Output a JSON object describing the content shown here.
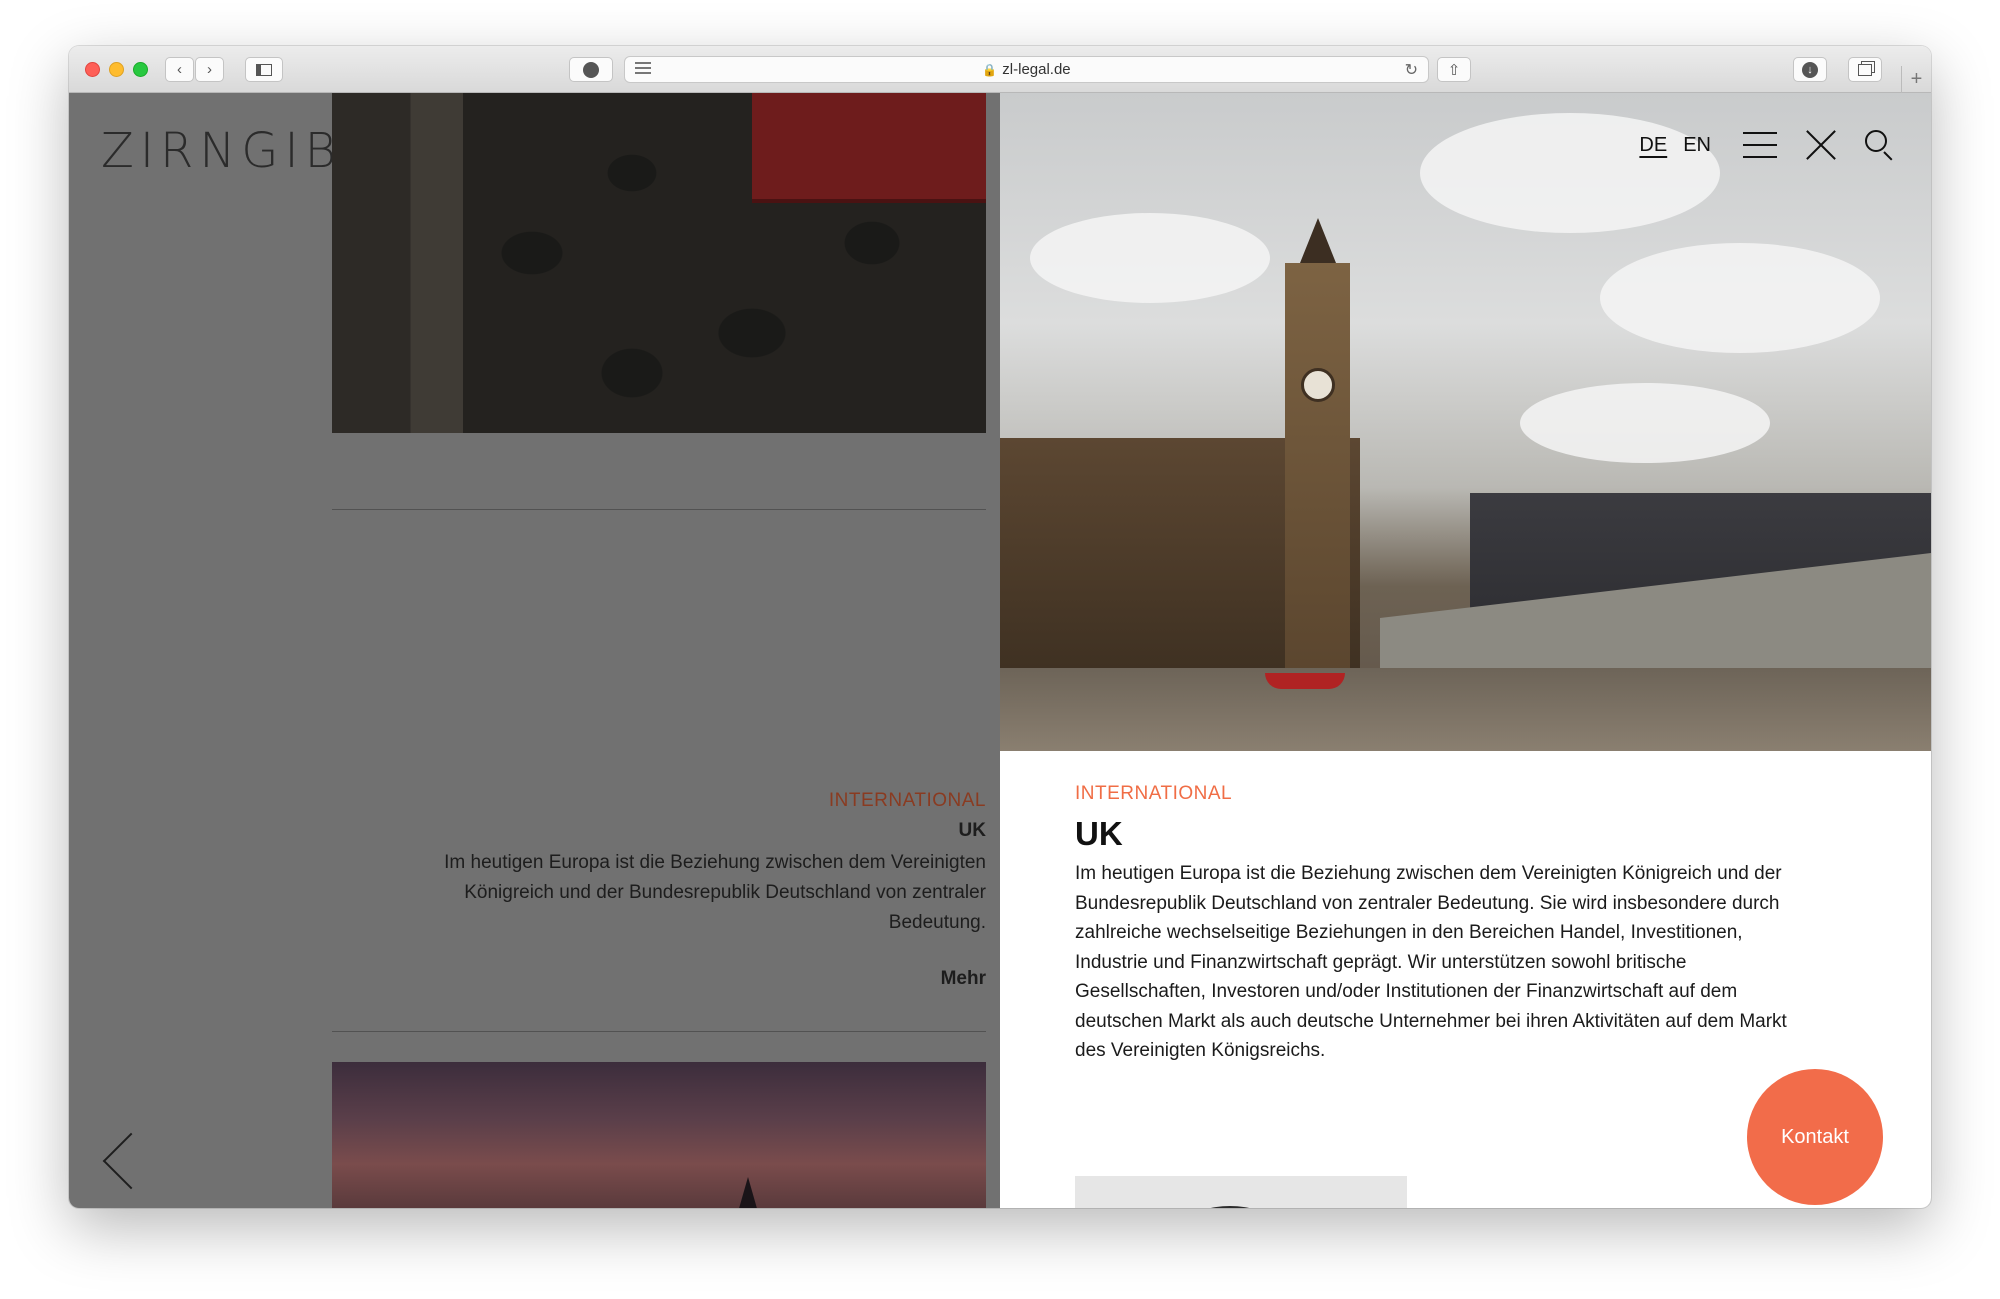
{
  "browser": {
    "url": "zl-legal.de"
  },
  "site": {
    "logo": "ZIRNGIBL"
  },
  "left_card": {
    "category": "INTERNATIONAL",
    "title": "UK",
    "text": "Im heutigen Europa ist die Beziehung zwischen dem Vereinigten Königreich und der Bundesrepublik Deutschland von zentraler Bedeutung.",
    "more_label": "Mehr"
  },
  "nav": {
    "lang_de": "DE",
    "lang_en": "EN"
  },
  "panel": {
    "category": "INTERNATIONAL",
    "title": "UK",
    "text": "Im heutigen Europa ist die Beziehung zwischen dem Vereinigten Königreich und der Bundesrepublik Deutschland von zentraler Bedeutung. Sie wird insbesondere durch zahlreiche wechselseitige Beziehungen in den Bereichen Handel, Investitionen, Industrie und Finanzwirtschaft geprägt. Wir unterstützen sowohl britische Gesellschaften, Investoren und/oder Institutionen der Finanzwirtschaft auf dem deutschen Markt als auch deutsche Unternehmer bei ihren Aktivitäten auf dem Markt des Vereinigten Königsreichs."
  },
  "contact_button": "Kontakt",
  "colors": {
    "accent": "#f26c4a",
    "category_text": "#f06d45",
    "overlay_gray": "#717171"
  },
  "icons": [
    "close-icon",
    "minimize-icon",
    "zoom-icon",
    "back-icon",
    "forward-icon",
    "sidebar-icon",
    "grammarly-icon",
    "reader-icon",
    "lock-icon",
    "reload-icon",
    "share-icon",
    "downloads-icon",
    "tabs-icon",
    "new-tab-icon",
    "menu-icon",
    "close-icon",
    "search-icon",
    "chevron-left-icon"
  ]
}
